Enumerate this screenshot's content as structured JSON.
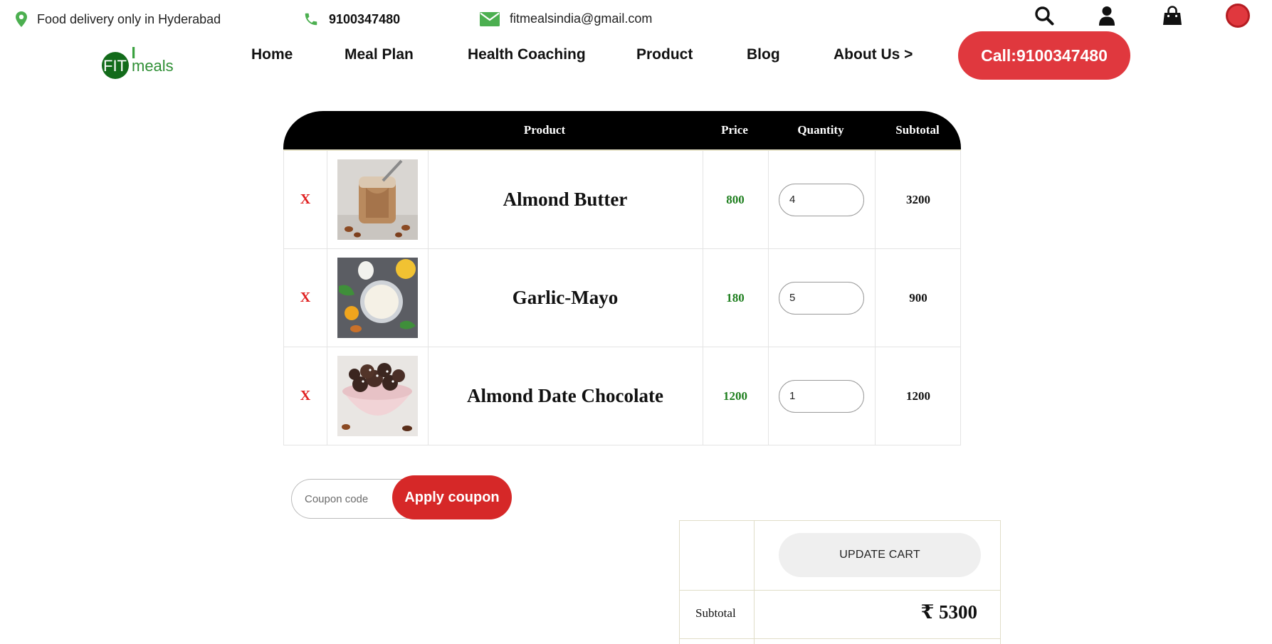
{
  "topbar": {
    "location": "Food delivery only in Hyderabad",
    "phone": "9100347480",
    "email": "fitmealsindia@gmail.com"
  },
  "icons": {
    "location": "map-pin-icon",
    "phone": "phone-icon",
    "email": "envelope-icon",
    "search": "search-icon",
    "account": "user-icon",
    "cart": "shopping-bag-icon"
  },
  "logo": {
    "text_fit": "FIT",
    "text_meals": "meals"
  },
  "nav": {
    "items": [
      "Home",
      "Meal Plan",
      "Health Coaching",
      "Product",
      "Blog",
      "About Us >"
    ],
    "call_label": "Call:9100347480"
  },
  "cart": {
    "headers": {
      "product": "Product",
      "price": "Price",
      "quantity": "Quantity",
      "subtotal": "Subtotal"
    },
    "remove_label": "X",
    "rows": [
      {
        "name": "Almond Butter",
        "price": "800",
        "quantity": "4",
        "subtotal": "3200"
      },
      {
        "name": "Garlic-Mayo",
        "price": "180",
        "quantity": "5",
        "subtotal": "900"
      },
      {
        "name": "Almond Date Chocolate",
        "price": "1200",
        "quantity": "1",
        "subtotal": "1200"
      }
    ]
  },
  "coupon": {
    "placeholder": "Coupon code",
    "apply_label": "Apply coupon"
  },
  "totals": {
    "update_label": "UPDATE CART",
    "subtotal_label": "Subtotal",
    "subtotal_value": "₹ 5300"
  },
  "colors": {
    "accent_red": "#e0383e",
    "price_green": "#1f7f1f",
    "header_black": "#000000",
    "icon_green": "#4caf50"
  }
}
